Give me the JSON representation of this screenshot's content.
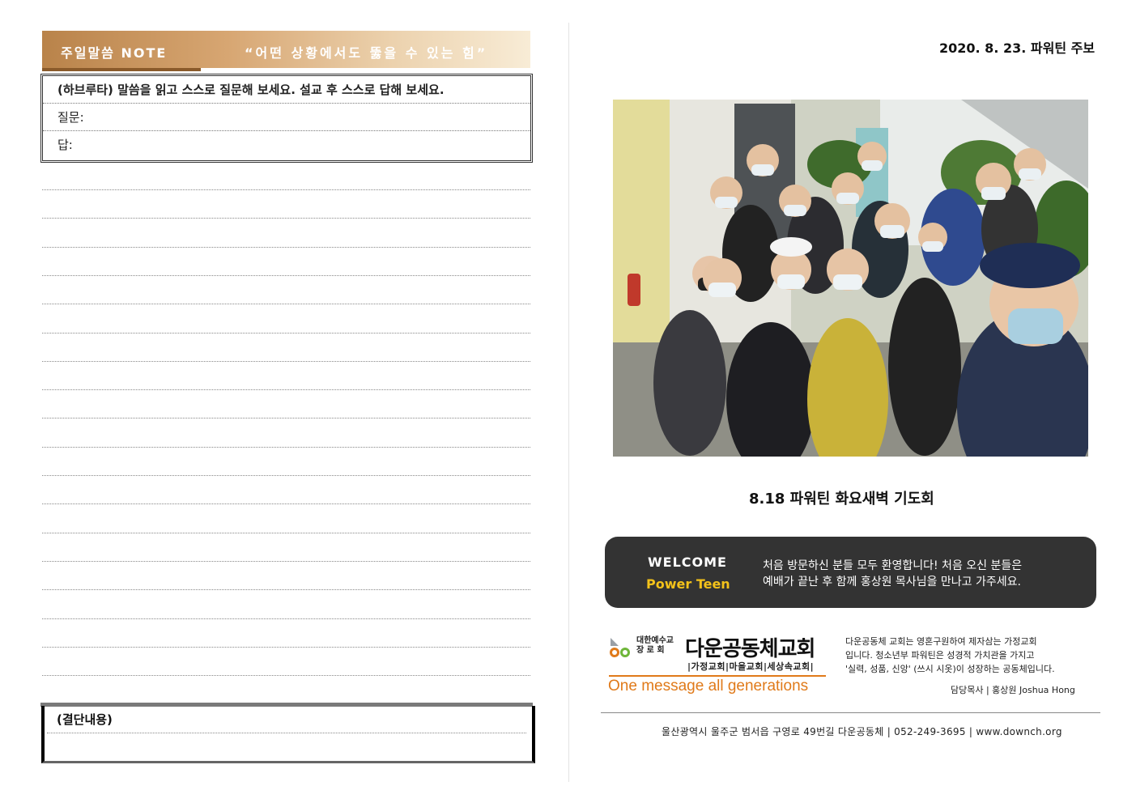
{
  "left_page": {
    "banner": {
      "title": "주일말씀 NOTE",
      "quote": "“어떤 상황에서도 뚫을 수 있는 힘”"
    },
    "qa": {
      "instruction": "(하브루타) 말씀을 읽고 스스로 질문해 보세요. 설교 후 스스로 답해 보세요.",
      "question_label": "질문:",
      "answer_label": "답:"
    },
    "resolution_label": "(결단내용)"
  },
  "right_page": {
    "issue_date": "2020. 8. 23. 파워틴 주보",
    "photo_caption": "8.18 파워틴 화요새벽 기도회",
    "welcome": {
      "title": "WELCOME",
      "subtitle": "Power Teen",
      "message_line1": "처음 방문하신 분들 모두 환영합니다! 처음 오신 분들은",
      "message_line2": "예배가 끝난 후 함께 홍상원 목사님을 만나고 가주세요."
    },
    "logo": {
      "denomination_line1": "대한예수교",
      "denomination_line2": "장 로 회",
      "church_name": "다운공동체교회",
      "tags": "|가정교회|마을교회|세상속교회|",
      "slogan": "One message all generations"
    },
    "description": {
      "line1": "다운공동체 교회는 영혼구원하여 제자삼는 가정교회",
      "line2": "입니다. 청소년부 파워틴은 성경적 가치관을 가지고",
      "line3": "'실력, 성품, 신앙' (쓰시 시옷)이 성장하는 공동체입니다.",
      "pastor": "담당목사 | 홍상원 Joshua Hong"
    },
    "footer": "울산광역시 울주군 범서읍 구영로 49번길 다운공동체 | 052-249-3695 | www.downch.org"
  },
  "colors": {
    "banner_gold": "#c9925a",
    "welcome_bg": "#333333",
    "welcome_accent": "#f3c21a",
    "slogan_orange": "#e07a1a"
  }
}
